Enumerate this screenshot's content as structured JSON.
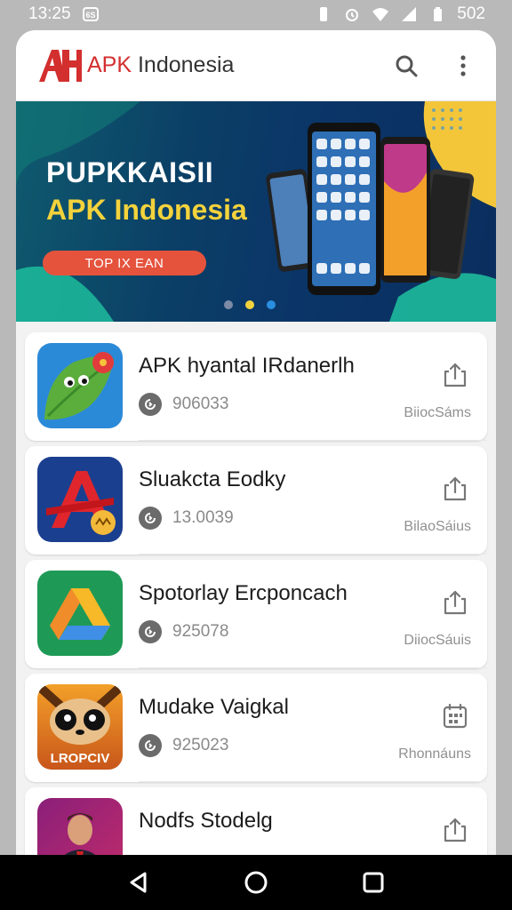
{
  "status_bar": {
    "time": "13:25",
    "battery": "502",
    "icons": [
      "notification-icon",
      "vibrate-icon",
      "alarm-icon",
      "wifi-icon",
      "signal-icon",
      "battery-icon"
    ]
  },
  "app_bar": {
    "brand_prefix": "APK",
    "brand_suffix": " Indonesia",
    "icons": [
      "search-icon",
      "more-vert-icon"
    ]
  },
  "banner": {
    "title": "PUPKKAISII",
    "subtitle": "APK Indonesia",
    "button_label": "TOP IX EAN",
    "colors": {
      "title": "#ffffff",
      "subtitle": "#f3d23c",
      "button": "#e5533d"
    }
  },
  "apps": [
    {
      "title": "APK hyantal IRdanerlh",
      "count": "906033",
      "status": "BiiocSáms",
      "action_icon": "share-icon"
    },
    {
      "title": "Sluakcta Eodky",
      "count": "13.0039",
      "status": "BilaoSáius",
      "action_icon": "share-icon"
    },
    {
      "title": "Spotorlay Ercponcach",
      "count": "925078",
      "status": "DiiocSáuis",
      "action_icon": "share-icon"
    },
    {
      "title": "Mudake Vaigkal",
      "count": "925023",
      "status": "Rhonnáuns",
      "action_icon": "calendar-icon",
      "icon_text": "LROPCIV"
    },
    {
      "title": "Nodfs Stodelg",
      "count": "",
      "status": "",
      "action_icon": "share-icon"
    }
  ],
  "nav": [
    "back-icon",
    "home-icon",
    "recents-icon"
  ]
}
